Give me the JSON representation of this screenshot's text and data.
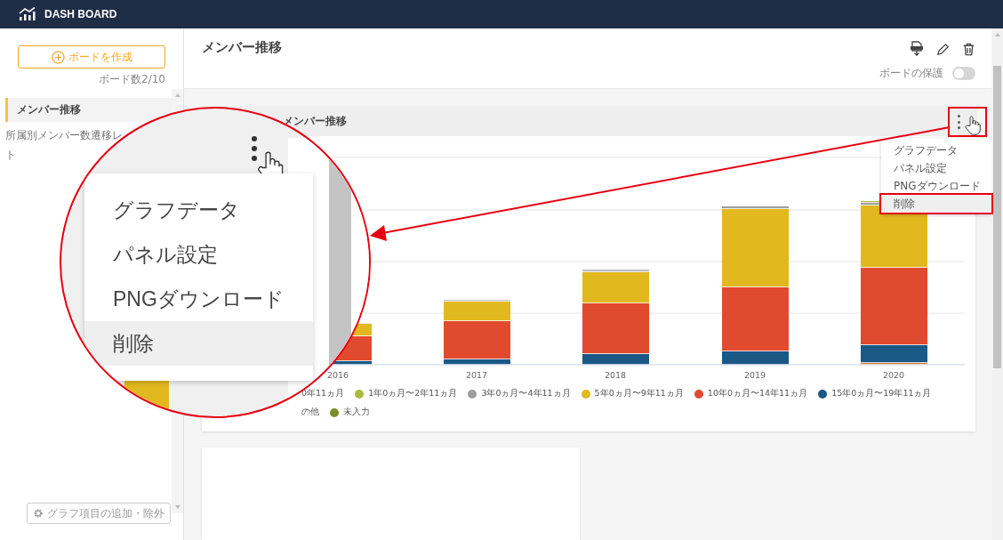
{
  "app": {
    "title": "DASH BOARD"
  },
  "sidebar": {
    "create_button": "ボードを作成",
    "board_count": "ボード数2/10",
    "items": [
      {
        "label": "メンバー推移",
        "selected": true
      },
      {
        "label": "所属別メンバー数遷移レ",
        "label_continued": "ト",
        "selected": false
      }
    ],
    "footer_button": "グラフ項目の追加・除外"
  },
  "page": {
    "title": "メンバー推移",
    "protect_label": "ボードの保護",
    "protect_on": false
  },
  "panel": {
    "title": "メンバー推移",
    "menu": [
      {
        "label": "グラフデータ",
        "selected": false
      },
      {
        "label": "パネル設定",
        "selected": false
      },
      {
        "label": "PNGダウンロード",
        "selected": false
      },
      {
        "label": "削除",
        "selected": true
      }
    ],
    "x_labels": [
      "2016",
      "2017",
      "2018",
      "2019",
      "2020"
    ],
    "legend": [
      {
        "label": "0年11ヵ月"
      },
      {
        "label": "1年0ヵ月〜2年11ヵ月",
        "color": "#a9bb3a"
      },
      {
        "label": "3年0ヵ月〜4年11ヵ月",
        "color": "#9e9e9e"
      },
      {
        "label": "5年0ヵ月〜9年11ヵ月",
        "color": "#e2b81f"
      },
      {
        "label": "10年0ヵ月〜14年11ヵ月",
        "color": "#e04a2e"
      },
      {
        "label": "15年0ヵ月〜19年11ヵ月",
        "color": "#1a5886"
      },
      {
        "label": "の他"
      },
      {
        "label": "未入力",
        "color": "#7a8f2a"
      }
    ]
  },
  "callout": {
    "menu": [
      {
        "label": "グラフデータ",
        "selected": false
      },
      {
        "label": "パネル設定",
        "selected": false
      },
      {
        "label": "PNGダウンロード",
        "selected": false
      },
      {
        "label": "削除",
        "selected": true
      }
    ]
  }
}
